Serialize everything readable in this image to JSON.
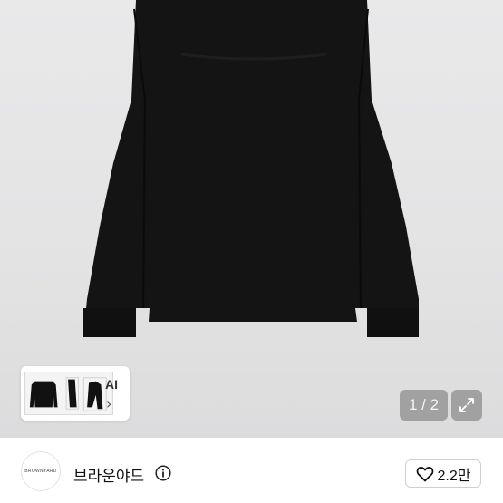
{
  "product": {
    "image_alt": "black long sleeve t-shirt"
  },
  "gallery": {
    "thumbnail_label": "AI",
    "thumbnail_chevron": "›",
    "counter": "1 / 2",
    "expand_icon": "expand-icon"
  },
  "shop": {
    "logo_text": "BROWNYARD",
    "name": "브라운야드",
    "info_icon": "info-icon"
  },
  "like": {
    "icon": "heart-icon",
    "count": "2.2만"
  }
}
